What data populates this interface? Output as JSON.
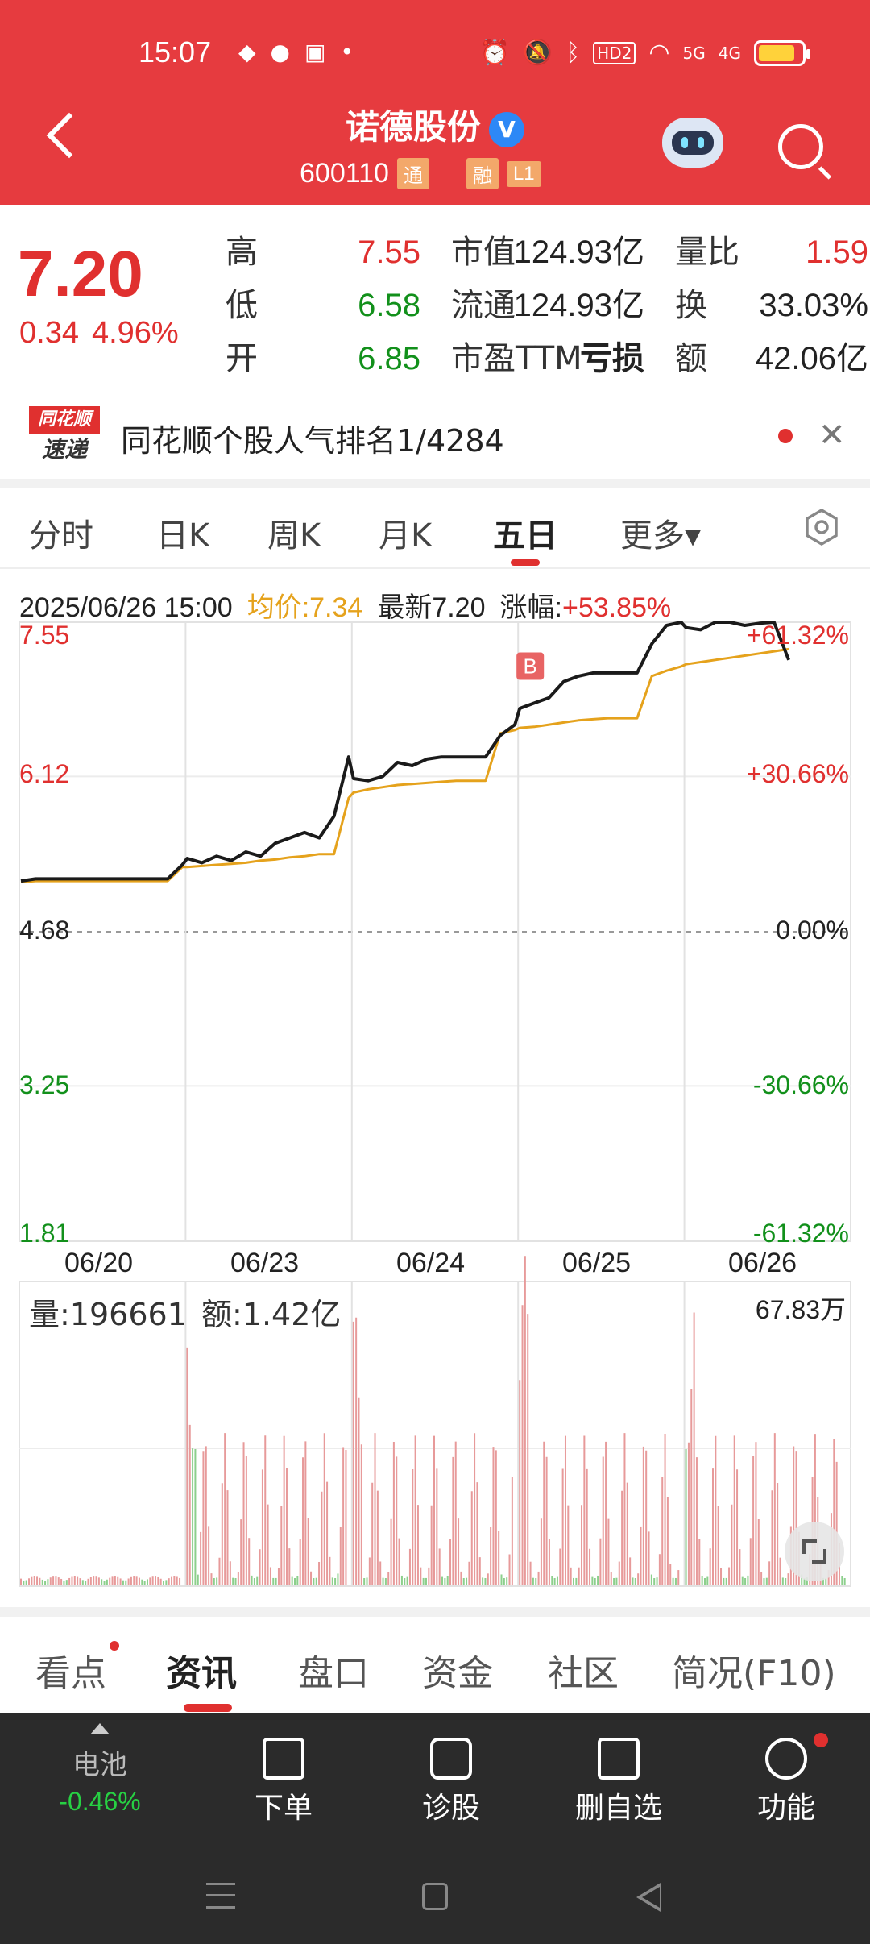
{
  "status_bar": {
    "time": "15:07",
    "hd_label": "HD2",
    "sig1_label": "5G",
    "sig2_label": "4G"
  },
  "header": {
    "title": "诺德股份",
    "verified_mark": "V",
    "code": "600110",
    "tags": [
      "通",
      "融",
      "L1"
    ]
  },
  "quote": {
    "price": "7.20",
    "change": "0.34",
    "change_pct": "4.96%",
    "rows": [
      {
        "l1": "高",
        "v1": "7.55",
        "l2": "市值",
        "v2": "124.93亿",
        "l3": "量比",
        "v3": "1.59"
      },
      {
        "l1": "低",
        "v1": "6.58",
        "l2": "流通",
        "v2": "124.93亿",
        "l3": "换",
        "v3": "33.03%"
      },
      {
        "l1": "开",
        "v1": "6.85",
        "l2": "市盈TTM",
        "v2": "亏损",
        "l3": "额",
        "v3": "42.06亿"
      }
    ]
  },
  "news": {
    "logo_top": "同花顺",
    "logo_bottom": "速递",
    "text": "同花顺个股人气排名1/4284",
    "close": "✕"
  },
  "tabs": [
    {
      "label": "分时"
    },
    {
      "label": "日K"
    },
    {
      "label": "周K"
    },
    {
      "label": "月K"
    },
    {
      "label": "五日"
    },
    {
      "label": "更多▾"
    }
  ],
  "chart_head": {
    "datetime": "2025/06/26 15:00",
    "avg": "均价:7.34",
    "latest": "最新7.20",
    "rise_label": "涨幅:",
    "rise_value": "+53.85%"
  },
  "colors": {
    "up": "#e0302f",
    "down": "#12901b",
    "price_line": "#1a1a1a",
    "avg_line": "#e5a21c"
  },
  "chart_data": {
    "type": "line",
    "days": [
      "06/20",
      "06/23",
      "06/24",
      "06/25",
      "06/26"
    ],
    "y_ticks": [
      "7.55",
      "6.12",
      "4.68",
      "3.25",
      "1.81"
    ],
    "pct_ticks": [
      "+61.32%",
      "+30.66%",
      "0.00%",
      "-30.66%",
      "-61.32%"
    ],
    "ylim": [
      1.81,
      7.55
    ],
    "series": [
      {
        "values": [
          5.15,
          5.17,
          5.17,
          5.17,
          5.17,
          5.17,
          5.17,
          5.17,
          5.17,
          5.17,
          5.17,
          5.3,
          5.36,
          5.32,
          5.38,
          5.34,
          5.42,
          5.38,
          5.5,
          5.55,
          5.6,
          5.55,
          5.75,
          6.3,
          6.1,
          6.08,
          6.12,
          6.25,
          6.22,
          6.28,
          6.3,
          6.3,
          6.3,
          6.3,
          6.5,
          6.6,
          6.75,
          6.8,
          6.85,
          7.0,
          7.05,
          7.08,
          7.08,
          7.08,
          7.08,
          7.35,
          7.52,
          7.55,
          7.5,
          7.48,
          7.55,
          7.55,
          7.52,
          7.54,
          7.55,
          7.2
        ]
      },
      {
        "values": [
          5.14,
          5.15,
          5.15,
          5.15,
          5.15,
          5.15,
          5.15,
          5.15,
          5.15,
          5.15,
          5.15,
          5.28,
          5.28,
          5.29,
          5.3,
          5.31,
          5.32,
          5.34,
          5.35,
          5.37,
          5.38,
          5.4,
          5.4,
          5.92,
          5.97,
          6.0,
          6.02,
          6.04,
          6.05,
          6.06,
          6.07,
          6.08,
          6.08,
          6.08,
          6.52,
          6.55,
          6.57,
          6.58,
          6.6,
          6.62,
          6.64,
          6.65,
          6.66,
          6.66,
          6.66,
          7.05,
          7.1,
          7.14,
          7.16,
          7.18,
          7.2,
          7.22,
          7.24,
          7.26,
          7.28,
          7.3
        ]
      }
    ],
    "volume": {
      "label": "量:196661",
      "amount": "额:1.42亿",
      "max": "67.83万"
    },
    "buy_marker": "B"
  },
  "content_tabs": [
    {
      "label": "看点"
    },
    {
      "label": "资讯"
    },
    {
      "label": "盘口"
    },
    {
      "label": "资金"
    },
    {
      "label": "社区"
    },
    {
      "label": "简况(F10)"
    }
  ],
  "actions": {
    "battery_label": "电池",
    "battery_pct": "-0.46%",
    "items": [
      {
        "label": "下单",
        "icon": "order-icon"
      },
      {
        "label": "诊股",
        "icon": "diagnose-icon"
      },
      {
        "label": "删自选",
        "icon": "remove-watchlist-icon"
      },
      {
        "label": "功能",
        "icon": "function-icon"
      }
    ]
  }
}
